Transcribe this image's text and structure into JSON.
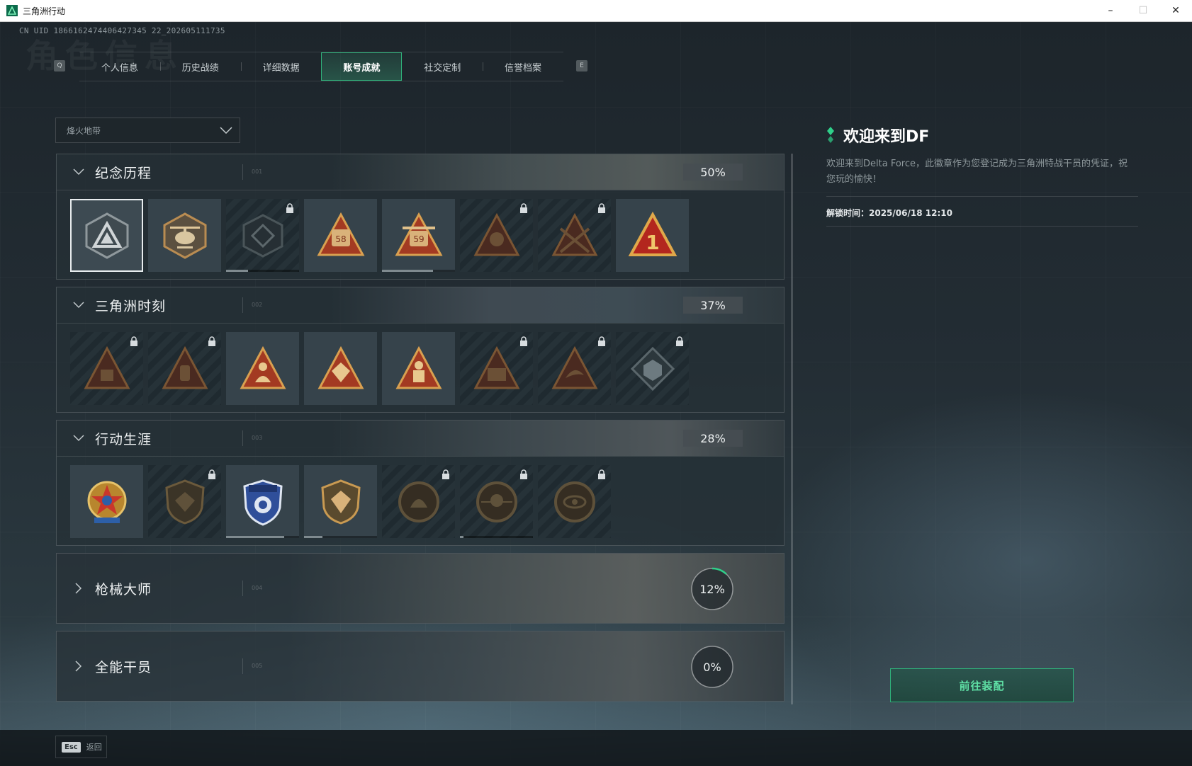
{
  "window": {
    "title": "三角洲行动",
    "minimize": "–",
    "maximize": "☐",
    "close": "✕"
  },
  "uid": "CN UID 1866162474406427345 22_202605111735",
  "tabs": {
    "left_key": "Q",
    "right_key": "E",
    "items": [
      "个人信息",
      "历史战绩",
      "详细数据",
      "账号成就",
      "社交定制",
      "信誉档案"
    ],
    "active": "账号成就"
  },
  "mode_select": {
    "value": "烽火地带"
  },
  "sections": [
    {
      "title": "纪念历程",
      "num": "001",
      "percent": "50%",
      "expanded": true,
      "badges": [
        {
          "icon": "delta-triangle-badge-icon",
          "locked": false,
          "selected": true
        },
        {
          "icon": "helicopter-badge-icon",
          "locked": false
        },
        {
          "icon": "dark-shield-badge-icon",
          "locked": true,
          "progress": 0.3
        },
        {
          "icon": "number-58-badge-icon",
          "locked": false,
          "text": "58"
        },
        {
          "icon": "number-59-badge-icon",
          "locked": false,
          "text": "59",
          "progress": 0.7
        },
        {
          "icon": "skull-triangle-badge-icon",
          "locked": true
        },
        {
          "icon": "crossed-rifles-badge-icon",
          "locked": true
        },
        {
          "icon": "number-one-badge-icon",
          "locked": false,
          "text": "1"
        }
      ]
    },
    {
      "title": "三角洲时刻",
      "num": "002",
      "percent": "37%",
      "expanded": true,
      "badges": [
        {
          "icon": "crate-triangle-badge-icon",
          "locked": true
        },
        {
          "icon": "canister-triangle-badge-icon",
          "locked": true
        },
        {
          "icon": "mermaid-triangle-badge-icon",
          "locked": false
        },
        {
          "icon": "gem-triangle-badge-icon",
          "locked": false
        },
        {
          "icon": "soldier-triangle-badge-icon",
          "locked": false
        },
        {
          "icon": "mech-triangle-badge-icon",
          "locked": true
        },
        {
          "icon": "dolphin-triangle-badge-icon",
          "locked": true
        },
        {
          "icon": "cube-diamond-badge-icon",
          "locked": true
        }
      ]
    },
    {
      "title": "行动生涯",
      "num": "003",
      "percent": "28%",
      "expanded": true,
      "badges": [
        {
          "icon": "star-shield-badge-icon",
          "locked": false
        },
        {
          "icon": "eagle-shield-badge-icon",
          "locked": true
        },
        {
          "icon": "police-shield-badge-icon",
          "locked": false,
          "progress": 0.8
        },
        {
          "icon": "gem-shield-badge-icon",
          "locked": false,
          "progress": 0.25
        },
        {
          "icon": "shell-circle-badge-icon",
          "locked": true
        },
        {
          "icon": "skull-circle-badge-icon",
          "locked": true,
          "progress": 0.05
        },
        {
          "icon": "eye-circle-badge-icon",
          "locked": true
        }
      ]
    }
  ],
  "collapsed_sections": [
    {
      "title": "枪械大师",
      "num": "004",
      "percent": "12%",
      "progress": 0.12
    },
    {
      "title": "全能干员",
      "num": "005",
      "percent": "0%",
      "progress": 0
    }
  ],
  "detail": {
    "title": "欢迎来到DF",
    "description": "欢迎来到Delta Force，此徽章作为您登记成为三角洲特战干员的凭证，祝您玩的愉快！",
    "unlock_time": "解锁时间：2025/06/18 12:10",
    "equip_button": "前往装配"
  },
  "bottom": {
    "esc_key": "Esc",
    "esc_label": "返回"
  },
  "colors": {
    "accent": "#2fb07a",
    "badge_gold": "#c8863a",
    "badge_red": "#b3261e"
  }
}
